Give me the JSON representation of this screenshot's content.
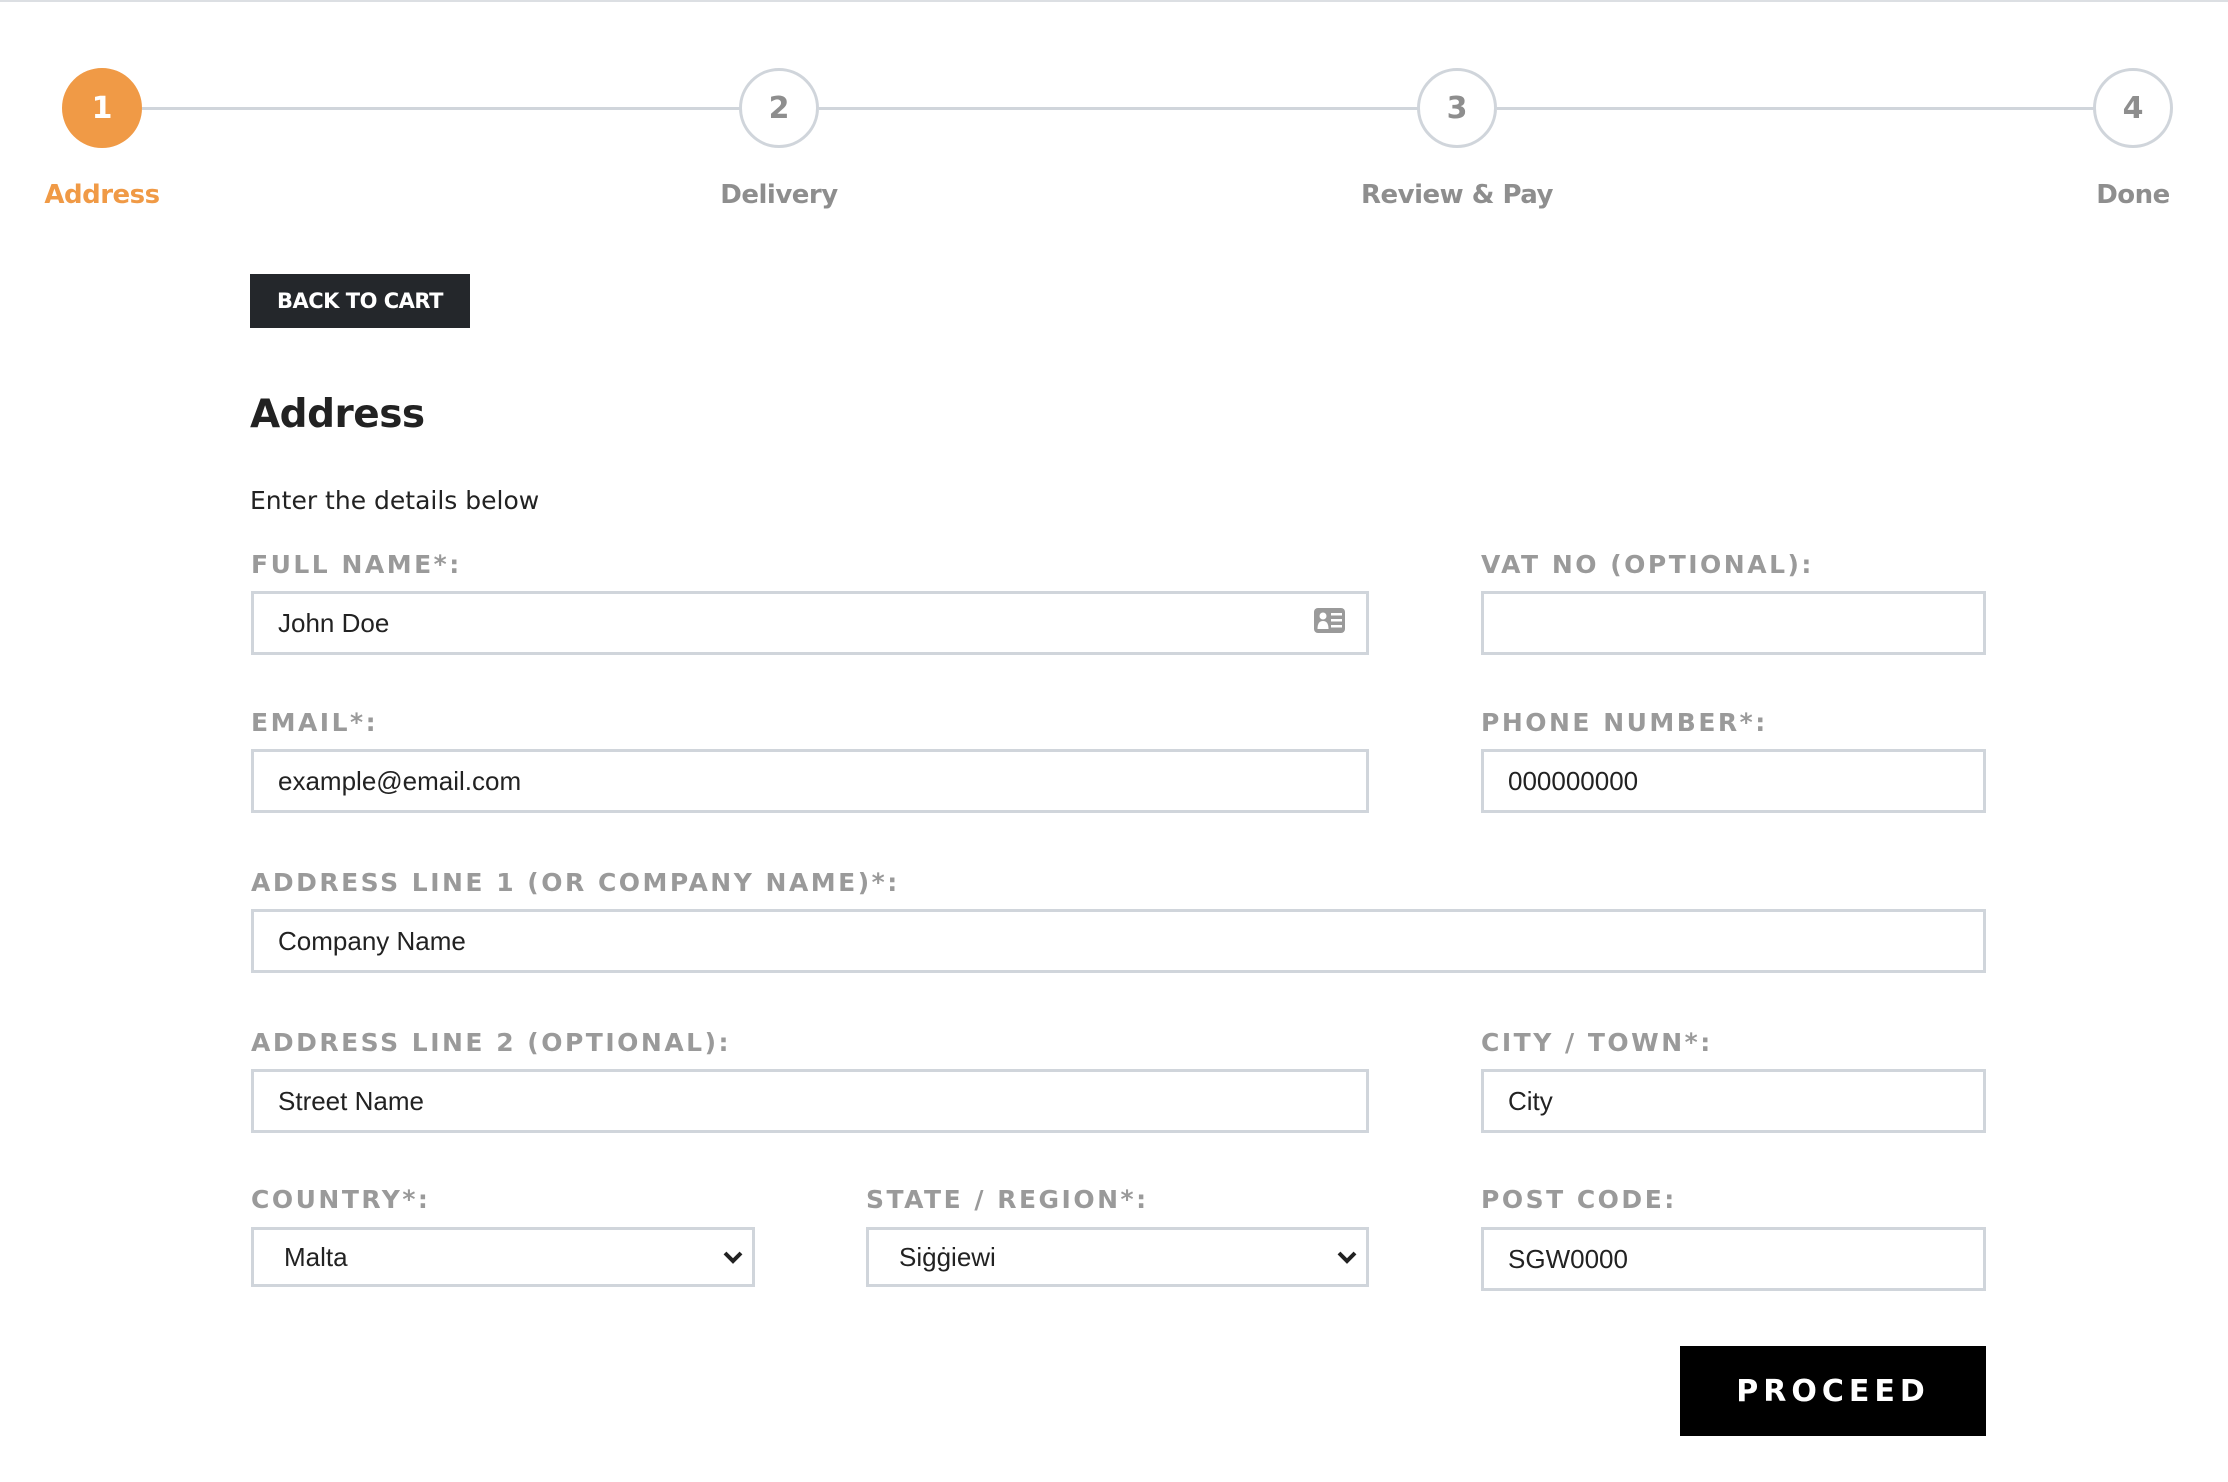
{
  "stepper": {
    "steps": [
      {
        "number": "1",
        "label": "Address",
        "state": "active"
      },
      {
        "number": "2",
        "label": "Delivery",
        "state": "inactive"
      },
      {
        "number": "3",
        "label": "Review & Pay",
        "state": "inactive"
      },
      {
        "number": "4",
        "label": "Done",
        "state": "inactive"
      }
    ],
    "active_color": "#f09a46",
    "inactive_color": "#d0d5db"
  },
  "back_button": {
    "label": "BACK TO CART"
  },
  "form": {
    "title": "Address",
    "subtitle": "Enter the details below",
    "full_name": {
      "label": "FULL NAME*:",
      "value": "John Doe",
      "icon": "contact-card-icon"
    },
    "vat_no": {
      "label": "VAT NO (OPTIONAL):",
      "value": ""
    },
    "email": {
      "label": "EMAIL*:",
      "value": "example@email.com"
    },
    "phone": {
      "label": "PHONE NUMBER*:",
      "value": "000000000"
    },
    "address1": {
      "label": "ADDRESS LINE 1 (OR COMPANY NAME)*:",
      "value": "Company Name"
    },
    "address2": {
      "label": "ADDRESS LINE 2 (OPTIONAL):",
      "value": "Street Name"
    },
    "city": {
      "label": "CITY / TOWN*:",
      "value": "City"
    },
    "country": {
      "label": "COUNTRY*:",
      "selected": "Malta"
    },
    "state": {
      "label": "STATE / REGION*:",
      "selected": "Siġġiewi"
    },
    "post_code": {
      "label": "POST CODE:",
      "value": "SGW0000"
    }
  },
  "proceed_button": {
    "label": "PROCEED"
  }
}
